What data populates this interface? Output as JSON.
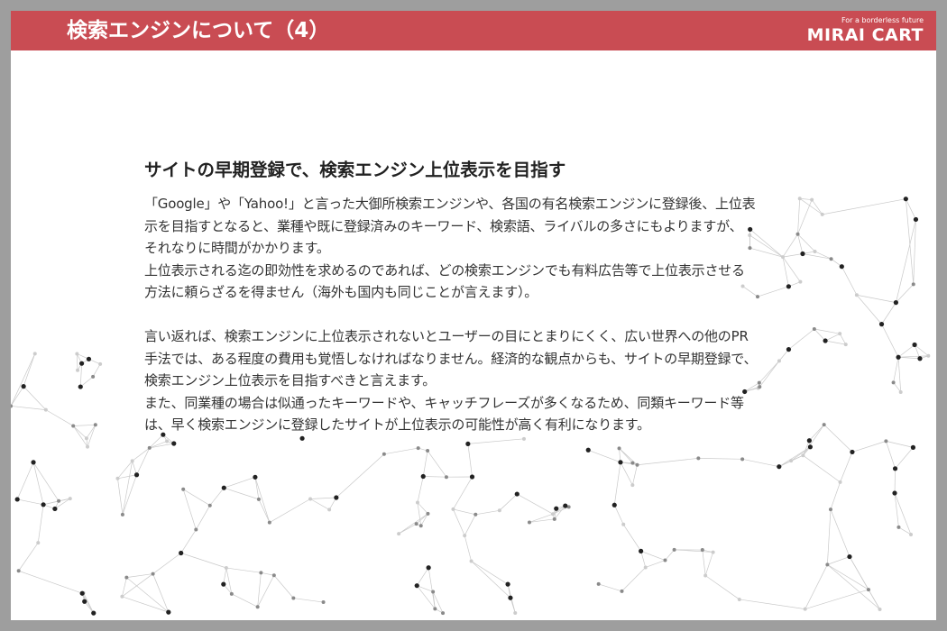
{
  "header": {
    "title": "検索エンジンについて（4）",
    "color": "#c94c53"
  },
  "logo": {
    "tagline": "For a borderless future",
    "name": "MIRAI CART"
  },
  "content": {
    "heading": "サイトの早期登録で、検索エンジン上位表示を目指す",
    "lines1": [
      "「Google」や「Yahoo!」と言った大御所検索エンジンや、各国の有名検索エンジンに登録後、上位表",
      "示を目指すとなると、業種や既に登録済みのキーワード、検索語、ライバルの多さにもよりますが、",
      "それなりに時間がかかります。",
      "上位表示される迄の即効性を求めるのであれば、どの検索エンジンでも有料広告等で上位表示させる",
      "方法に頼らざるを得ません（海外も国内も同じことが言えます）。"
    ],
    "lines2": [
      "言い返れば、検索エンジンに上位表示されないとユーザーの目にとまりにくく、広い世界への他のPR",
      "手法では、ある程度の費用も覚悟しなければなりません。経済的な観点からも、サイトの早期登録で、",
      "検索エンジン上位表示を目指すべきと言えます。",
      "また、同業種の場合は似通ったキーワードや、キャッチフレーズが多くなるため、同類キーワード等",
      "は、早く検索エンジンに登録したサイトが上位表示の可能性が高く有利になります。"
    ]
  }
}
